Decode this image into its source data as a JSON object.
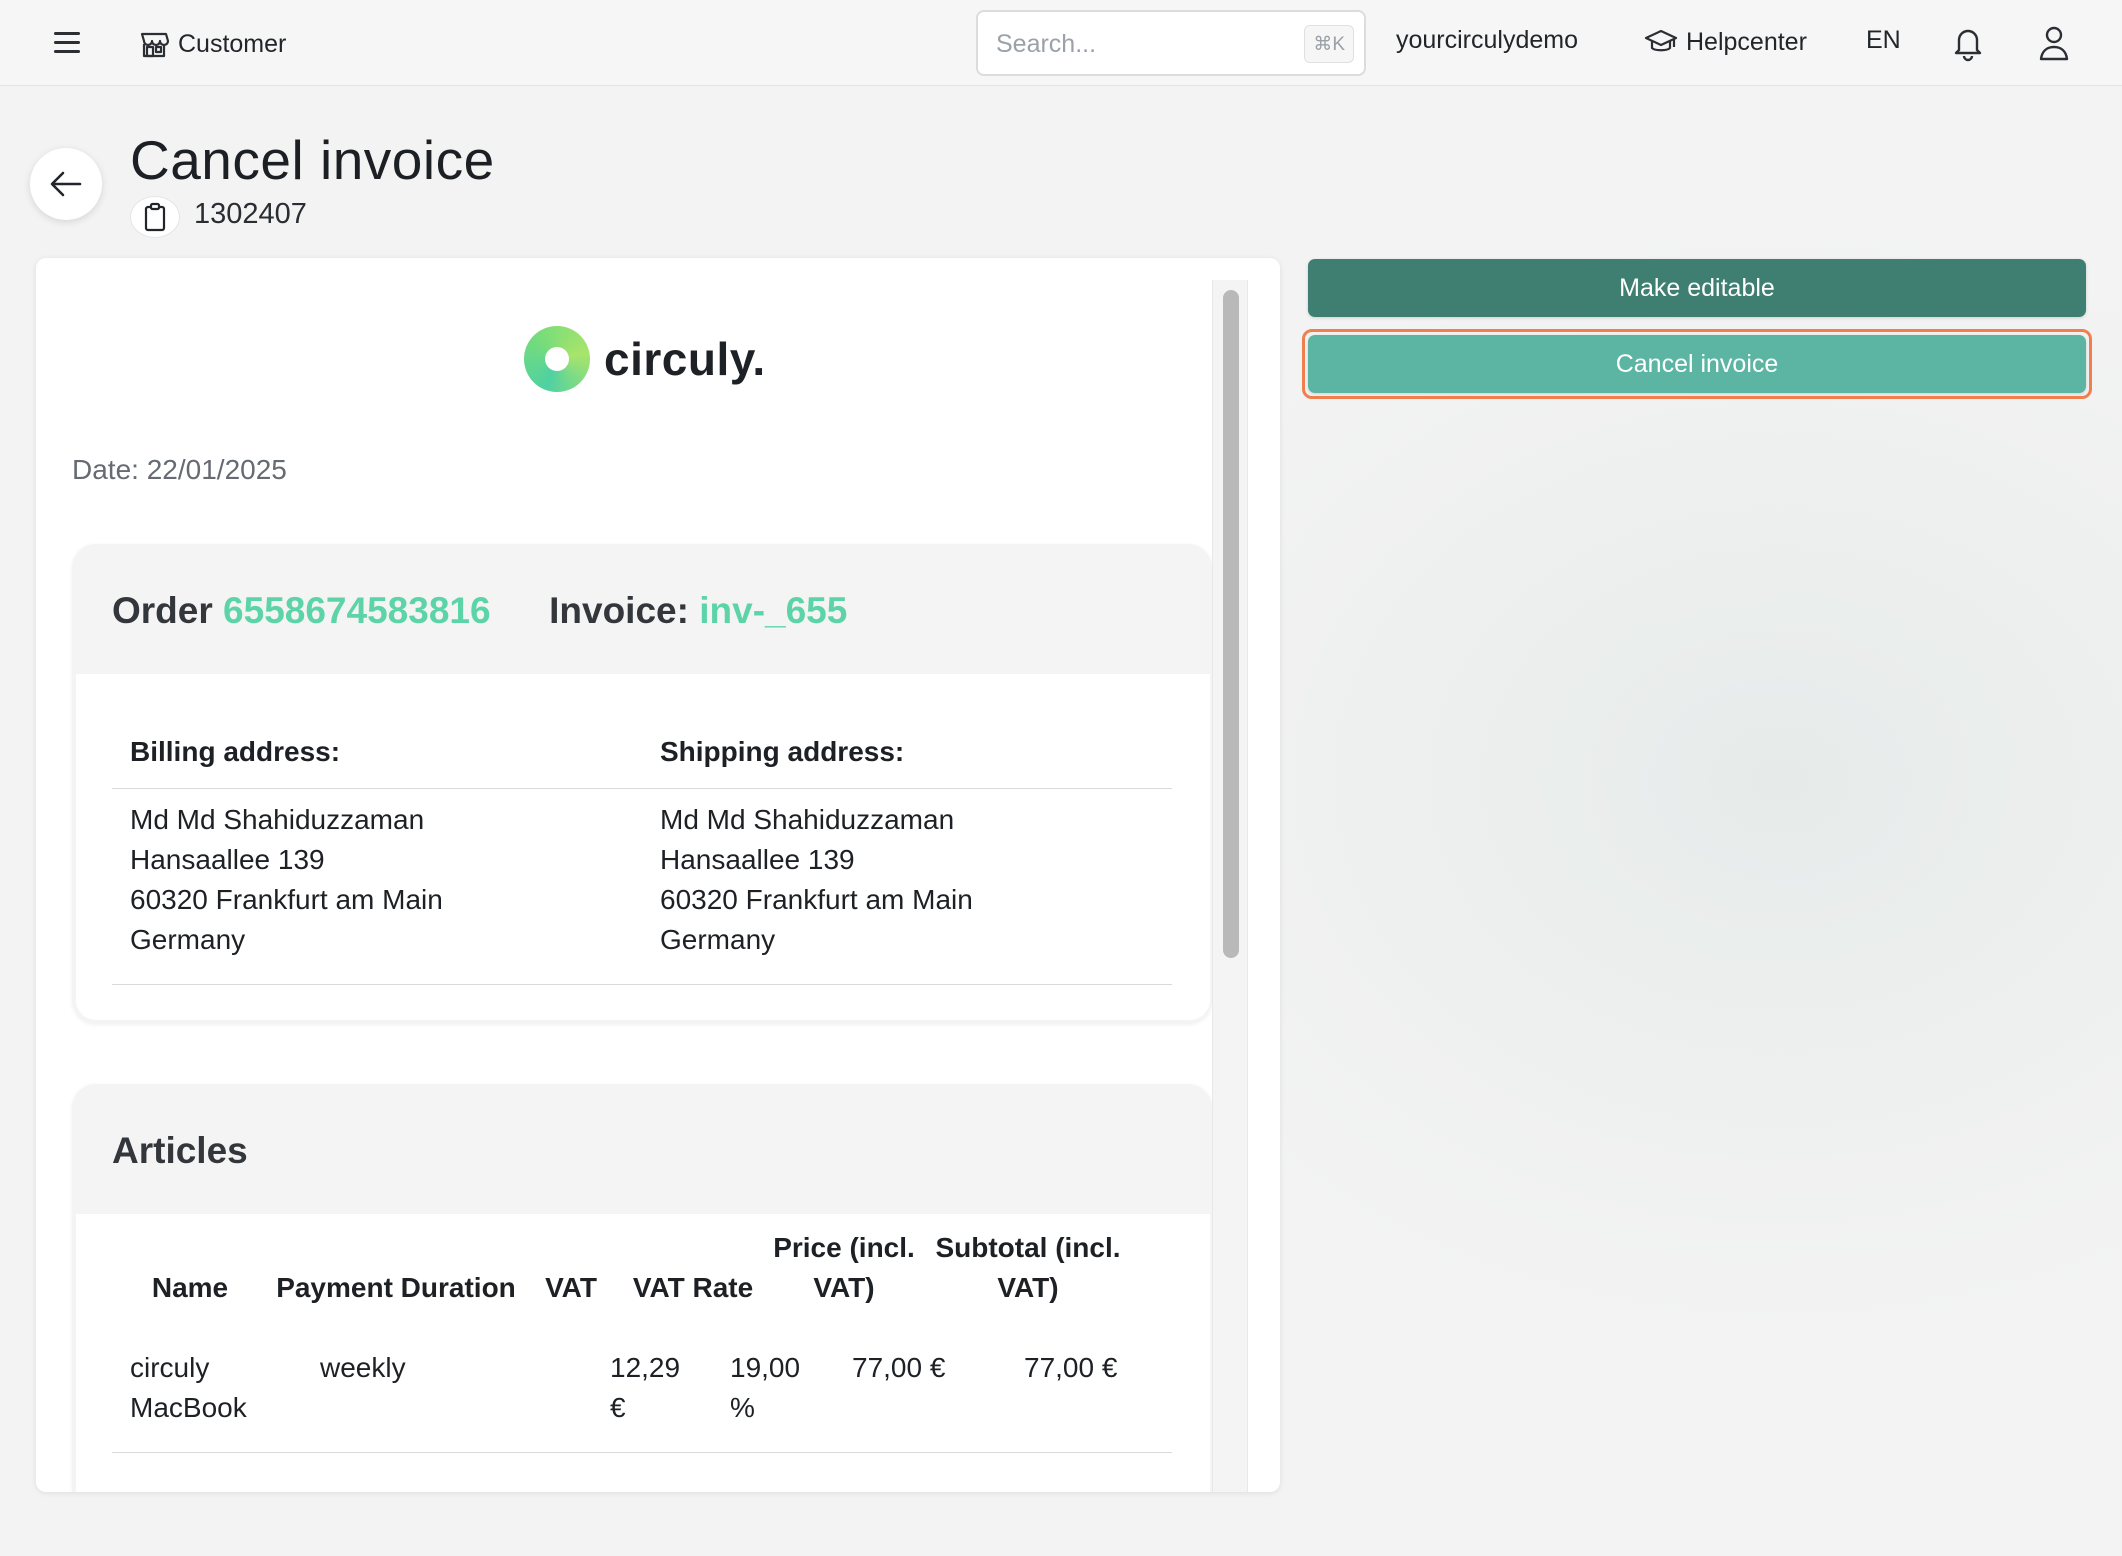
{
  "topbar": {
    "context_label": "Customer",
    "search_placeholder": "Search...",
    "search_shortcut": "⌘K",
    "tenant": "yourcirculydemo",
    "help_label": "Helpcenter",
    "language": "EN"
  },
  "header": {
    "title": "Cancel invoice",
    "invoice_id": "1302407"
  },
  "invoice": {
    "logo_text": "circuly.",
    "date_label": "Date:",
    "date_value": "22/01/2025",
    "order_label": "Order",
    "order_number": "6558674583816",
    "invoice_label": "Invoice:",
    "invoice_number": "inv-_655",
    "billing": {
      "title": "Billing address:",
      "name": "Md Md Shahiduzzaman",
      "street": "Hansaallee 139",
      "city": "60320 Frankfurt am Main",
      "country": "Germany"
    },
    "shipping": {
      "title": "Shipping address:",
      "name": "Md Md Shahiduzzaman",
      "street": "Hansaallee 139",
      "city": "60320 Frankfurt am Main",
      "country": "Germany"
    },
    "articles": {
      "title": "Articles",
      "columns": {
        "name": "Name",
        "duration": "Payment Duration",
        "vat": "VAT",
        "vat_rate": "VAT Rate",
        "price_1": "Price (incl.",
        "price_2": "VAT)",
        "subtotal_1": "Subtotal (incl.",
        "subtotal_2": "VAT)"
      },
      "rows": [
        {
          "name_1": "circuly",
          "name_2": "MacBook",
          "duration": "weekly",
          "vat_1": "12,29",
          "vat_2": "€",
          "vat_rate_1": "19,00",
          "vat_rate_2": "%",
          "price": "77,00 €",
          "subtotal": "77,00 €"
        }
      ]
    }
  },
  "actions": {
    "make_editable": "Make editable",
    "cancel_invoice": "Cancel invoice"
  },
  "colors": {
    "accent": "#5dd4a8",
    "primary_dark": "#3f7f72",
    "primary_light": "#5bb5a2",
    "focus": "#f07f4f"
  }
}
